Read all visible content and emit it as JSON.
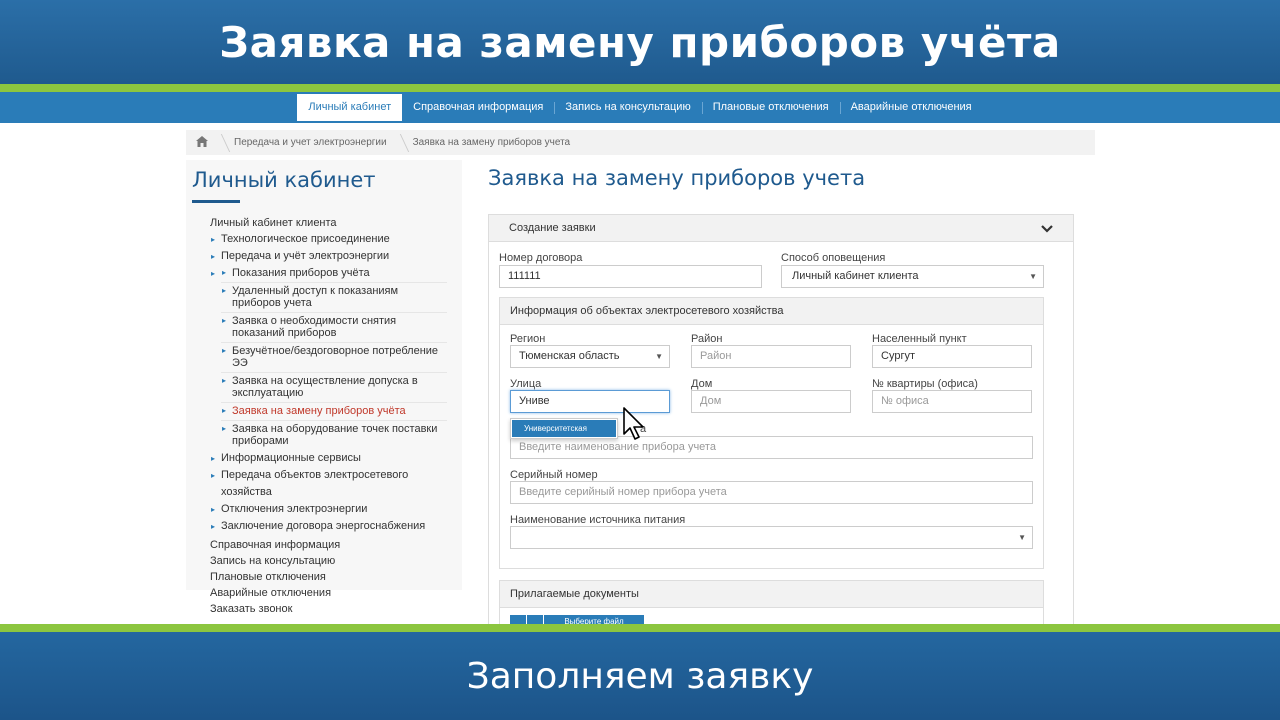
{
  "banner": {
    "title": "Заявка на замену приборов учёта",
    "subtitle": "Заполняем заявку"
  },
  "nav": {
    "items": [
      {
        "label": "Личный кабинет",
        "active": true
      },
      {
        "label": "Справочная информация"
      },
      {
        "label": "Запись на консультацию"
      },
      {
        "label": "Плановые отключения"
      },
      {
        "label": "Аварийные отключения"
      }
    ]
  },
  "breadcrumb": {
    "home_icon": "home-icon",
    "items": [
      "Передача и учет электроэнергии",
      "Заявка на замену приборов учета"
    ]
  },
  "sidebar": {
    "title": "Личный кабинет",
    "root_label": "Личный кабинет клиента",
    "sub": [
      "Технологическое присоединение",
      "Передача и учёт электроэнергии"
    ],
    "sub2": [
      "Показания приборов учёта",
      "Удаленный доступ к показаниям приборов учета",
      "Заявка о необходимости снятия показаний приборов",
      "Безучётное/бездоговорное потребление ЭЭ",
      "Заявка на осуществление допуска в эксплуатацию",
      "Заявка на замену приборов учёта",
      "Заявка на оборудование точек поставки приборами"
    ],
    "sub_after": [
      "Информационные сервисы",
      "Передача объектов электросетевого хозяйства",
      "Отключения электроэнергии",
      "Заключение договора энергоснабжения"
    ],
    "bottom": [
      "Справочная информация",
      "Запись на консультацию",
      "Плановые отключения",
      "Аварийные отключения",
      "Заказать звонок"
    ]
  },
  "main": {
    "title": "Заявка на замену приборов учета",
    "panel_title": "Создание заявки",
    "contract_label": "Номер договора",
    "contract_value": "111111",
    "notify_label": "Способ оповещения",
    "notify_value": "Личный кабинет клиента",
    "objects_title": "Информация об объектах электросетевого хозяйства",
    "region_label": "Регион",
    "region_value": "Тюменская область",
    "district_label": "Район",
    "district_placeholder": "Район",
    "city_label": "Населенный пункт",
    "city_value": "Сургут",
    "street_label": "Улица",
    "street_value": "Униве",
    "house_label": "Дом",
    "house_placeholder": "Дом",
    "apt_label": "№ квартиры (офиса)",
    "apt_placeholder": "№ офиса",
    "device_name_label_tail": "а",
    "device_name_placeholder": "Введите наименование прибора учета",
    "serial_label": "Серийный номер",
    "serial_placeholder": "Введите серийный номер прибора учета",
    "power_label": "Наименование источника питания",
    "power_value": "",
    "autocomplete_item": "Университетская",
    "docs_title": "Прилагаемые документы",
    "choose_file": "Выберите файл"
  }
}
